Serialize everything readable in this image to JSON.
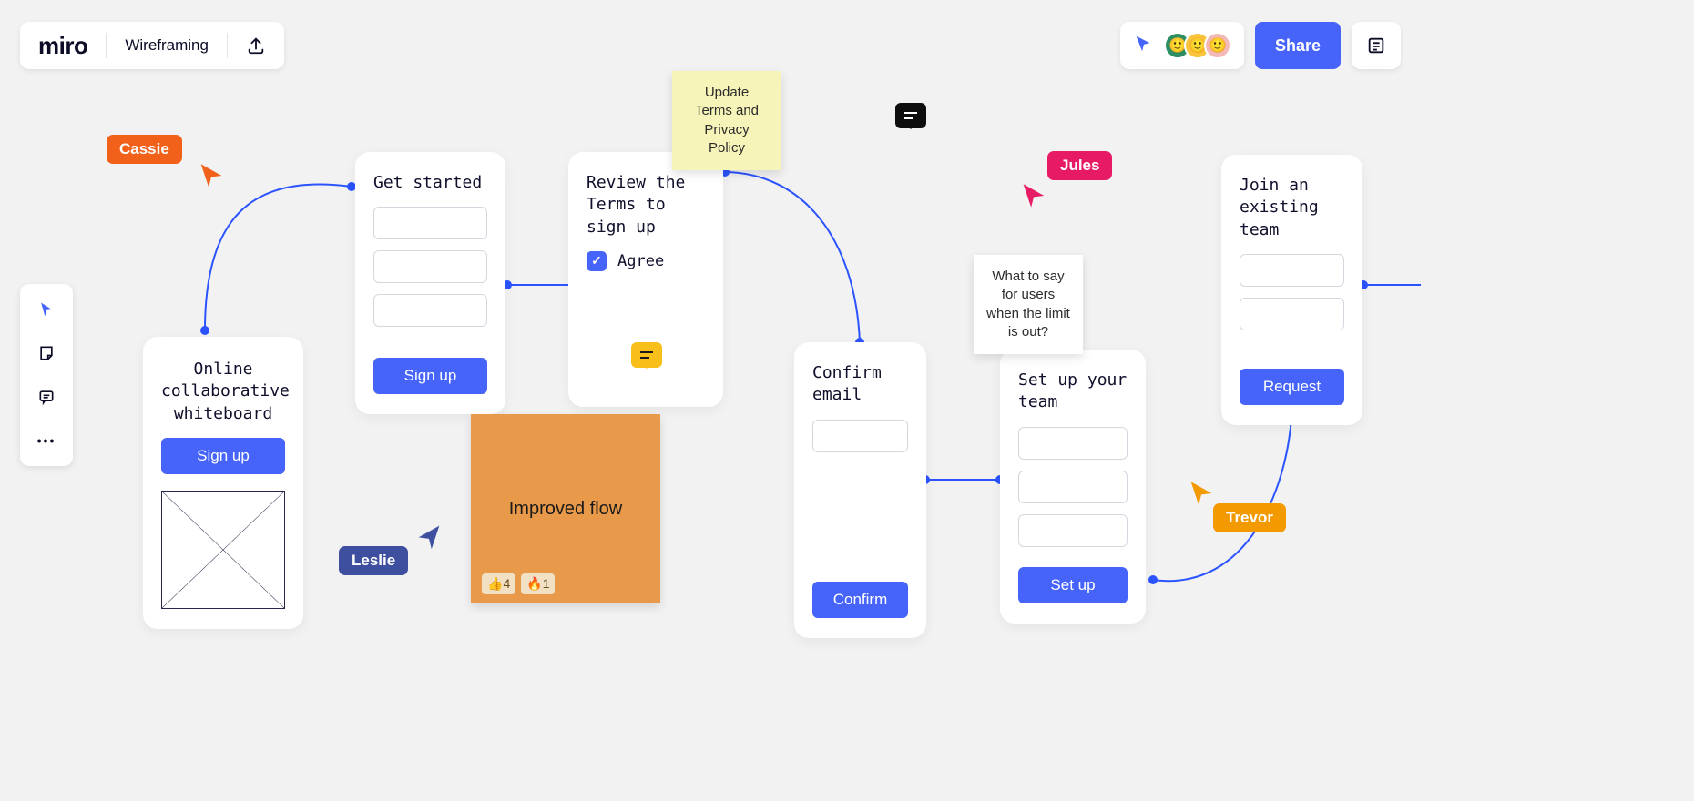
{
  "app": {
    "logo": "miro",
    "board_name": "Wireframing"
  },
  "share_label": "Share",
  "avatars": [
    {
      "bg": "#2b8f63"
    },
    {
      "bg": "#f9c43b"
    },
    {
      "bg": "#f3b9b9"
    }
  ],
  "toolbar_more": "•••",
  "wireframes": {
    "intro": {
      "title": "Online collaborative whiteboard",
      "button": "Sign up"
    },
    "started": {
      "title": "Get started",
      "button": "Sign up"
    },
    "review": {
      "title": "Review the Terms to sign up",
      "agree": "Agree"
    },
    "confirm": {
      "title": "Confirm email",
      "button": "Confirm"
    },
    "team": {
      "title": "Set up your team",
      "button": "Set up"
    },
    "join": {
      "title": "Join an existing team",
      "button": "Request"
    }
  },
  "stickies": {
    "terms": "Update Terms and Privacy Policy",
    "flow": "Improved flow",
    "limit": "What to say for users when the limit is out?"
  },
  "reactions": {
    "thumbs": {
      "emoji": "👍",
      "count": "4"
    },
    "fire": {
      "emoji": "🔥",
      "count": "1"
    }
  },
  "cursors": {
    "cassie": "Cassie",
    "leslie": "Leslie",
    "jules": "Jules",
    "trevor": "Trevor"
  }
}
